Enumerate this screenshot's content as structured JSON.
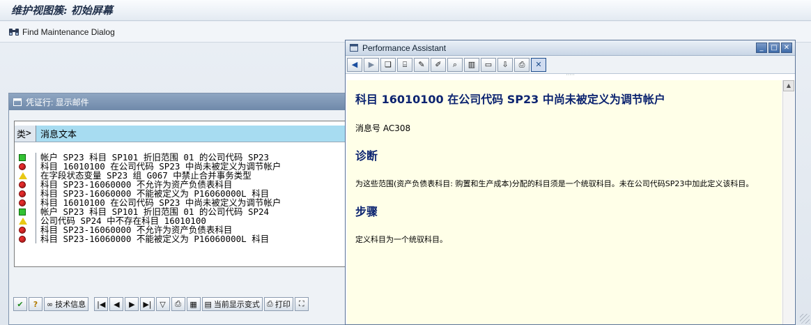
{
  "window": {
    "title": "维护视图簇: 初始屏幕"
  },
  "app_toolbar": {
    "find_label": "Find Maintenance Dialog"
  },
  "log_dialog": {
    "title": "凭证行: 显示邮件",
    "columns": {
      "type": "类",
      "message": "消息文本"
    },
    "rows": [
      {
        "status": "green",
        "text": "帐户 SP23 科目 SP101 折旧范围 01 的公司代码 SP23"
      },
      {
        "status": "red",
        "text": "科目 16010100 在公司代码 SP23 中尚未被定义为调节帐户"
      },
      {
        "status": "yellow",
        "text": "在字段状态变量 SP23 组 G067 中禁止合并事务类型"
      },
      {
        "status": "red",
        "text": "科目 SP23-16060000 不允许为资产负债表科目"
      },
      {
        "status": "red",
        "text": "科目 SP23-16060000 不能被定义为 P16060000L 科目"
      },
      {
        "status": "red",
        "text": "科目 16010100 在公司代码 SP23 中尚未被定义为调节帐户"
      },
      {
        "status": "green",
        "text": "帐户 SP23 科目 SP101 折旧范围 01 的公司代码 SP24"
      },
      {
        "status": "yellow",
        "text": "公司代码 SP24 中不存在科目 16010100"
      },
      {
        "status": "red",
        "text": "科目 SP23-16060000 不允许为资产负债表科目"
      },
      {
        "status": "red",
        "text": "科目 SP23-16060000 不能被定义为 P16060000L 科目"
      }
    ],
    "toolbar": {
      "tech_info_label": "技术信息",
      "current_layout_label": "当前显示变式",
      "print_label": "打印"
    }
  },
  "perf_assistant": {
    "title": "Performance Assistant",
    "heading": "科目  16010100 在公司代码  SP23 中尚未被定义为调节帐户",
    "message_no": "消息号  AC308",
    "diagnosis_heading": "诊断",
    "diagnosis_text": "为这些范围(资产负债表科目: 购置和生产成本)分配的科目须是一个统驭科目。未在公司代码SP23中加此定义该科目。",
    "procedure_heading": "步骤",
    "procedure_text": "定义科目为一个统驭科目。"
  },
  "colors": {
    "heading_blue": "#0c2470",
    "help_background": "#ffffe8",
    "header_highlight": "#a7dcf1",
    "lamp_green": "#33c233",
    "lamp_red": "#e42a2a",
    "lamp_yellow": "#e8c814"
  }
}
